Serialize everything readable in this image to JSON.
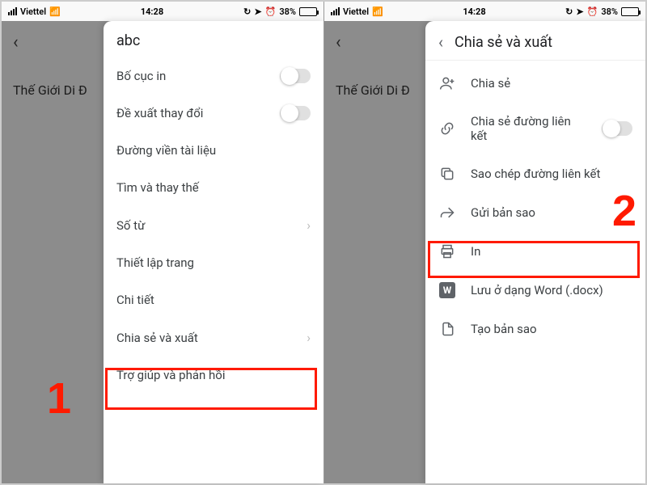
{
  "status": {
    "carrier": "Viettel",
    "time": "14:28",
    "battery_pct": "38%"
  },
  "background": {
    "doc_text": "Thế Giới Di Đ"
  },
  "left_panel": {
    "title": "abc",
    "items": {
      "print_layout": "Bố cục in",
      "suggest_changes": "Đề xuất thay đổi",
      "doc_outline": "Đường viền tài liệu",
      "find_replace": "Tìm và thay thế",
      "word_count": "Số từ",
      "page_setup": "Thiết lập trang",
      "details": "Chi tiết",
      "share_export": "Chia sẻ và xuất",
      "help_feedback": "Trợ giúp và phản hồi"
    }
  },
  "right_panel": {
    "title": "Chia sẻ và xuất",
    "items": {
      "share": "Chia sẻ",
      "share_link": "Chia sẻ đường liên kết",
      "copy_link": "Sao chép đường liên kết",
      "send_copy": "Gửi bản sao",
      "print": "In",
      "save_word": "Lưu ở dạng Word (.docx)",
      "make_copy": "Tạo bản sao"
    }
  },
  "annotations": {
    "step1": "1",
    "step2": "2"
  },
  "icons": {
    "w": "W"
  }
}
